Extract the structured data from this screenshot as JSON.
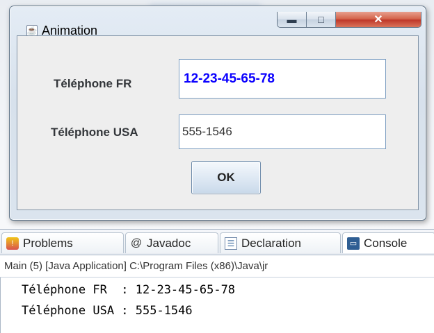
{
  "window": {
    "title": "Animation",
    "icon": "java-icon",
    "controls": {
      "minimize": "minimize-icon",
      "maximize": "maximize-icon",
      "close": "close-icon"
    }
  },
  "form": {
    "fr_label": "Téléphone FR",
    "fr_value": "12-23-45-65-78",
    "usa_label": "Téléphone USA",
    "usa_value": "555-1546",
    "ok_label": "OK",
    "fr_value_color": "#0b00ff"
  },
  "views": {
    "tabs": [
      {
        "label": "Problems",
        "icon": "problems-icon"
      },
      {
        "label": "Javadoc",
        "icon": "at-icon"
      },
      {
        "label": "Declaration",
        "icon": "declaration-icon"
      },
      {
        "label": "Console",
        "icon": "console-icon"
      }
    ]
  },
  "console": {
    "header": "Main (5) [Java Application] C:\\Program Files (x86)\\Java\\jr",
    "lines": [
      "Téléphone FR  : 12-23-45-65-78",
      "Téléphone USA : 555-1546"
    ]
  }
}
